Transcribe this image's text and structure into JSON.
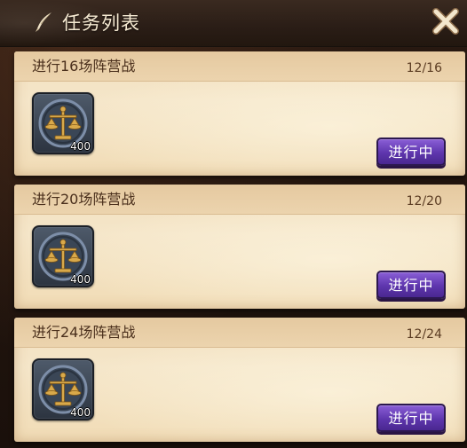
{
  "header": {
    "title": "任务列表",
    "title_icon": "quill-icon",
    "close_icon": "close-icon"
  },
  "tasks": [
    {
      "title": "进行16场阵营战",
      "progress": "12/16",
      "reward_icon": "scales-icon",
      "reward_count": "400",
      "status_label": "进行中"
    },
    {
      "title": "进行20场阵营战",
      "progress": "12/20",
      "reward_icon": "scales-icon",
      "reward_count": "400",
      "status_label": "进行中"
    },
    {
      "title": "进行24场阵营战",
      "progress": "12/24",
      "reward_icon": "scales-icon",
      "reward_count": "400",
      "status_label": "进行中"
    }
  ],
  "colors": {
    "status_button": "#5e36ad",
    "card_paper": "#f5e6c9",
    "header_bg": "#2a1d16"
  }
}
